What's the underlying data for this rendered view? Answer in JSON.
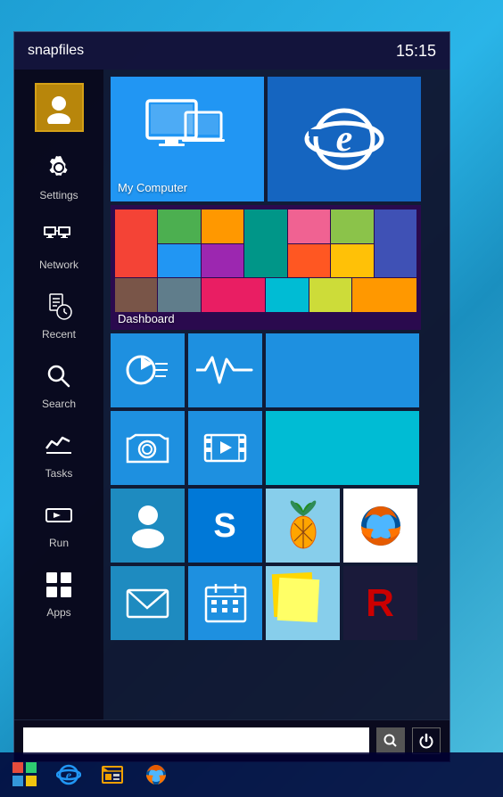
{
  "header": {
    "title": "snapfiles",
    "time": "15:15"
  },
  "sidebar": {
    "user_label": "User",
    "items": [
      {
        "id": "settings",
        "label": "Settings",
        "icon": "gear"
      },
      {
        "id": "network",
        "label": "Network",
        "icon": "network"
      },
      {
        "id": "recent",
        "label": "Recent",
        "icon": "recent"
      },
      {
        "id": "search",
        "label": "Search",
        "icon": "search"
      },
      {
        "id": "tasks",
        "label": "Tasks",
        "icon": "tasks"
      },
      {
        "id": "run",
        "label": "Run",
        "icon": "run"
      },
      {
        "id": "apps",
        "label": "Apps",
        "icon": "apps"
      }
    ]
  },
  "tiles": {
    "my_computer_label": "My Computer",
    "dashboard_label": "Dashboard"
  },
  "footer": {
    "search_placeholder": "",
    "search_icon": "search",
    "power_icon": "power"
  },
  "taskbar": {
    "items": [
      {
        "id": "start",
        "icon": "windows-logo"
      },
      {
        "id": "ie",
        "icon": "ie"
      },
      {
        "id": "explorer",
        "icon": "explorer"
      },
      {
        "id": "firefox",
        "icon": "firefox"
      }
    ]
  }
}
